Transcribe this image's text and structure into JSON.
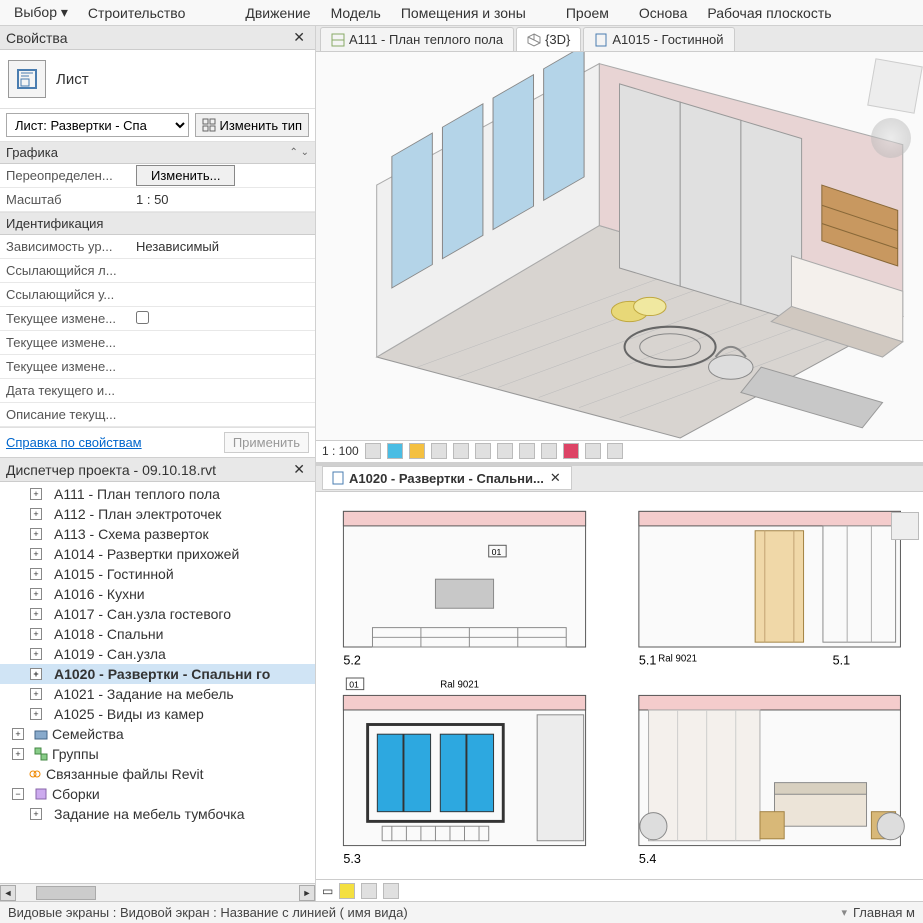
{
  "ribbon": {
    "items": [
      "Выбор",
      "Строительство",
      "Движение",
      "Модель",
      "Помещения и зоны",
      "Проем",
      "Основа",
      "Рабочая плоскость"
    ],
    "dropdown_marks": [
      true,
      false,
      false,
      false,
      false,
      false,
      false,
      false
    ]
  },
  "properties": {
    "title": "Свойства",
    "type_label": "Лист",
    "dropdown_value": "Лист: Развертки - Спа",
    "edit_type_label": "Изменить тип",
    "sections": {
      "graphics": "Графика",
      "identity": "Идентификация"
    },
    "rows": [
      {
        "label": "Переопределен...",
        "value": "",
        "button": "Изменить..."
      },
      {
        "label": "Масштаб",
        "value": "1 : 50"
      }
    ],
    "identity_rows": [
      {
        "label": "Зависимость ур...",
        "value": "Независимый"
      },
      {
        "label": "Ссылающийся л...",
        "value": ""
      },
      {
        "label": "Ссылающийся у...",
        "value": ""
      },
      {
        "label": "Текущее измене...",
        "value": "",
        "checkbox": true
      },
      {
        "label": "Текущее измене...",
        "value": ""
      },
      {
        "label": "Текущее измене...",
        "value": ""
      },
      {
        "label": "Дата текущего и...",
        "value": ""
      },
      {
        "label": "Описание текущ...",
        "value": ""
      }
    ],
    "help_link": "Справка по свойствам",
    "apply_label": "Применить"
  },
  "browser": {
    "title": "Диспетчер проекта - 09.10.18.rvt",
    "sheets": [
      "A111 - План теплого пола",
      "A112 - План электроточек",
      "A113 - Схема разверток",
      "A1014 - Развертки прихожей",
      "A1015 - Гостинной",
      "A1016 - Кухни",
      "A1017 - Сан.узла гостевого",
      "A1018 - Спальни",
      "A1019 - Сан.узла",
      "A1020 - Развертки - Спальни го",
      "A1021 - Задание на мебель",
      "A1025 - Виды из камер"
    ],
    "active_index": 9,
    "groups": [
      {
        "icon": "families",
        "label": "Семейства"
      },
      {
        "icon": "groups",
        "label": "Группы"
      },
      {
        "icon": "links",
        "label": "Связанные файлы Revit"
      },
      {
        "icon": "assemblies",
        "label": "Сборки"
      }
    ],
    "sub_item": "Задание на мебель тумбочка"
  },
  "views": {
    "top_tabs": [
      {
        "icon": "plan",
        "label": "A111 - План теплого пола"
      },
      {
        "icon": "3d",
        "label": "{3D}"
      },
      {
        "icon": "sheet",
        "label": "A1015 - Гостинной"
      }
    ],
    "active_top": 1,
    "scale_3d": "1 : 100",
    "bottom_tab": {
      "icon": "sheet",
      "label": "A1020 - Развертки - Спальни..."
    },
    "elevations": [
      {
        "label": "5.2",
        "note": "01"
      },
      {
        "label": "5.1",
        "note": "Ral 9021"
      },
      {
        "label": "5.3",
        "note_top": "01",
        "note2": "Ral 9021"
      },
      {
        "label": "5.4"
      }
    ]
  },
  "statusbar": {
    "left": "Видовые экраны : Видовой экран : Название с линией  ( имя вида)",
    "right": "Главная м"
  }
}
